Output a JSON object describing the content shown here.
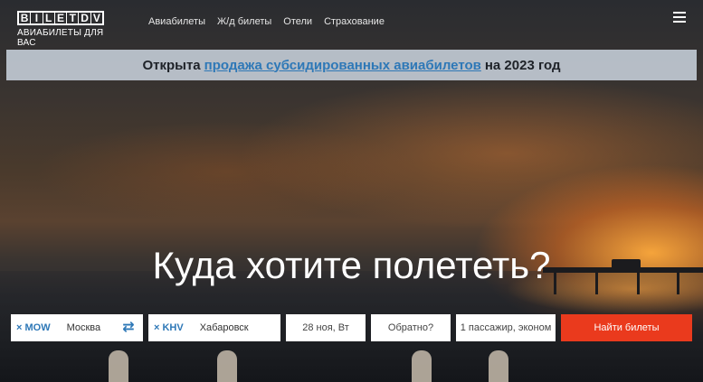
{
  "header": {
    "logo_letters": [
      "B",
      "I",
      "L",
      "E",
      "T",
      "D",
      "V"
    ],
    "logo_sub": "АВИАБИЛЕТЫ ДЛЯ ВАС",
    "nav": [
      {
        "label": "Авиабилеты"
      },
      {
        "label": "Ж/д билеты"
      },
      {
        "label": "Отели"
      },
      {
        "label": "Страхование"
      }
    ],
    "menu_icon": "hamburger-icon"
  },
  "banner": {
    "prefix": "Открыта",
    "link": "продажа субсидированных авиабилетов",
    "suffix": "на 2023 год"
  },
  "hero": {
    "title": "Куда хотите полететь?"
  },
  "search": {
    "origin_code": "× MOW",
    "origin_city": "Москва",
    "swap_icon": "swap-arrows-icon",
    "destination_code": "× KHV",
    "destination_city": "Хабаровск",
    "depart_date": "28 ноя, Вт",
    "return_date": "Обратно?",
    "passengers": "1 пассажир, эконом",
    "submit": "Найти билеты"
  },
  "colors": {
    "accent": "#2e78b7",
    "button": "#ea3a1d",
    "banner_bg": "#cdd6e0"
  }
}
